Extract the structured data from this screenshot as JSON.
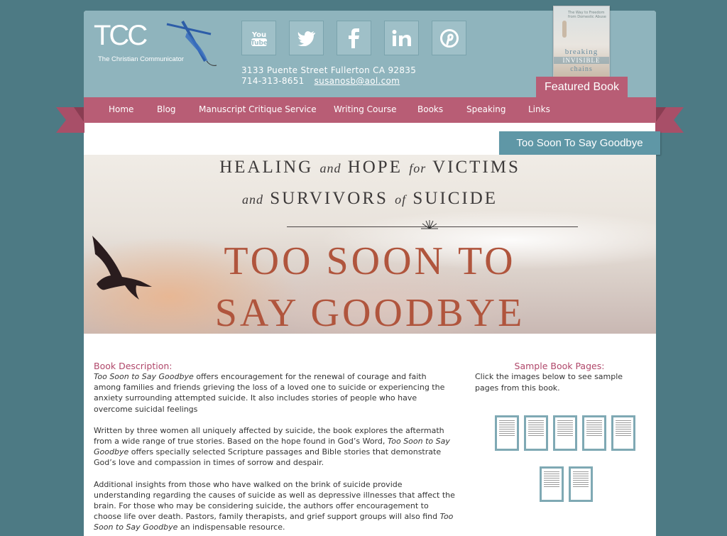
{
  "logo": {
    "text": "TCC",
    "tagline": "The Christian Communicator"
  },
  "social": [
    {
      "name": "youtube-icon",
      "label": "YouTube"
    },
    {
      "name": "twitter-icon",
      "label": "Twitter"
    },
    {
      "name": "facebook-icon",
      "label": "f"
    },
    {
      "name": "linkedin-icon",
      "label": "in"
    },
    {
      "name": "pinterest-icon",
      "label": "P"
    }
  ],
  "contact": {
    "address": "3133 Puente Street Fullerton CA 92835",
    "phone": "714-313-8651",
    "email": "susanosb@aol.com"
  },
  "featured": {
    "label": "Featured Book",
    "book_line1": "breaking",
    "book_line2": "INVISIBLE",
    "book_line3": "chains",
    "book_subtitle": "The Way to Freedom from Domestic Abuse"
  },
  "nav": {
    "items": [
      {
        "label": "Home"
      },
      {
        "label": "Blog"
      },
      {
        "label": "Manuscript Critique Service"
      },
      {
        "label": "Writing Course"
      },
      {
        "label": "Books"
      },
      {
        "label": "Speaking"
      },
      {
        "label": "Links"
      }
    ]
  },
  "page": {
    "tag": "Too Soon To Say Goodbye"
  },
  "banner": {
    "line1_a": "HEALING",
    "line1_b": "and",
    "line1_c": "HOPE",
    "line1_d": "for",
    "line1_e": "VICTIMS",
    "line2_a": "and",
    "line2_b": "SURVIVORS",
    "line2_c": "of",
    "line2_d": "SUICIDE",
    "title1": "TOO SOON TO",
    "title2": "SAY GOODBYE"
  },
  "description": {
    "heading": "Book Description:",
    "p1_title": "Too Soon to Say Goodbye",
    "p1_text": " offers encouragement for the renewal of courage and faith among families and friends grieving the loss of a loved one to suicide or experiencing the anxiety surrounding attempted suicide. It also includes stories of people who have overcome suicidal feelings",
    "p2_text_a": "Written by three women all uniquely affected by suicide, the book explores the aftermath from a wide range of true stories. Based on the hope found in God’s Word, ",
    "p2_title": "Too Soon to Say Goodbye",
    "p2_text_b": " offers specially selected Scripture passages and Bible stories that demonstrate God’s love and compassion in times of sorrow and despair.",
    "p3_text_a": "Additional insights from those who have walked on the brink of suicide provide understanding regarding the causes of suicide as well as depressive illnesses that affect the brain. For those who may be considering suicide, the authors offer encouragement to choose life over death. Pastors, family therapists, and grief support groups will also find ",
    "p3_title": "Too Soon to Say Goodbye",
    "p3_text_b": " an indispensable resource."
  },
  "sample": {
    "heading": "Sample Book Pages:",
    "text": "Click the images below to see sample pages from this book.",
    "pages": [
      "Sample page 1",
      "Sample page 2",
      "Sample page 3",
      "Sample page 4",
      "Sample page 5",
      "Sample page 6",
      "Sample page 7"
    ]
  },
  "colors": {
    "background": "#4d7a84",
    "header": "#8fb4bd",
    "accent": "#b85d75",
    "tag_blue": "#5f97a6",
    "heading": "#b0476a",
    "banner_title": "#b0553d"
  }
}
